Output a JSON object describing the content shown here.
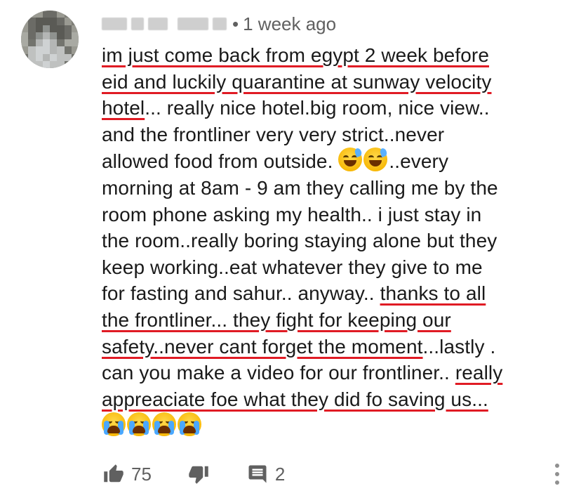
{
  "comment": {
    "time_ago": "1 week ago",
    "separator": "•",
    "lines": [
      [
        {
          "t": "im just come back from egypt 2 week before",
          "u": true
        }
      ],
      [
        {
          "t": "eid and luckily quarantine at sunway velocity",
          "u": true
        }
      ],
      [
        {
          "t": "hotel",
          "u": true
        },
        {
          "t": "... really nice hotel.big room, nice view..",
          "u": false
        }
      ],
      [
        {
          "t": "and the frontliner very very strict..never",
          "u": false
        }
      ],
      [
        {
          "t": "allowed food from outside. ",
          "u": false
        },
        {
          "emoji": "sweat-smile"
        },
        {
          "emoji": "sweat-smile"
        },
        {
          "t": "..every",
          "u": false
        }
      ],
      [
        {
          "t": "morning at 8am - 9 am they calling me by the",
          "u": false
        }
      ],
      [
        {
          "t": "room phone asking my health.. i just stay in",
          "u": false
        }
      ],
      [
        {
          "t": "the room..really boring staying alone but they",
          "u": false
        }
      ],
      [
        {
          "t": "keep working..eat whatever they give to me",
          "u": false
        }
      ],
      [
        {
          "t": "for fasting and sahur.. anyway.. ",
          "u": false
        },
        {
          "t": "thanks to all",
          "u": true
        }
      ],
      [
        {
          "t": "the frontliner... they fight for keeping our",
          "u": true
        }
      ],
      [
        {
          "t": "safety..never cant forget the moment",
          "u": true
        },
        {
          "t": "...lastly .",
          "u": false
        }
      ],
      [
        {
          "t": "can you make a video for our frontliner.. ",
          "u": false
        },
        {
          "t": "really",
          "u": true
        }
      ],
      [
        {
          "t": "appreaciate foe what they did fo saving us...",
          "u": true
        }
      ],
      [
        {
          "emoji": "loudly-crying"
        },
        {
          "emoji": "loudly-crying"
        },
        {
          "emoji": "loudly-crying"
        },
        {
          "emoji": "loudly-crying"
        }
      ]
    ]
  },
  "actions": {
    "like_icon": "thumbs-up-icon",
    "like_count": "75",
    "dislike_icon": "thumbs-down-icon",
    "reply_icon": "comment-icon",
    "reply_count": "2",
    "more_icon": "more-vertical-icon"
  },
  "colors": {
    "underline": "#e01b24",
    "meta_text": "#606060",
    "body_text": "#1a1a1a"
  }
}
